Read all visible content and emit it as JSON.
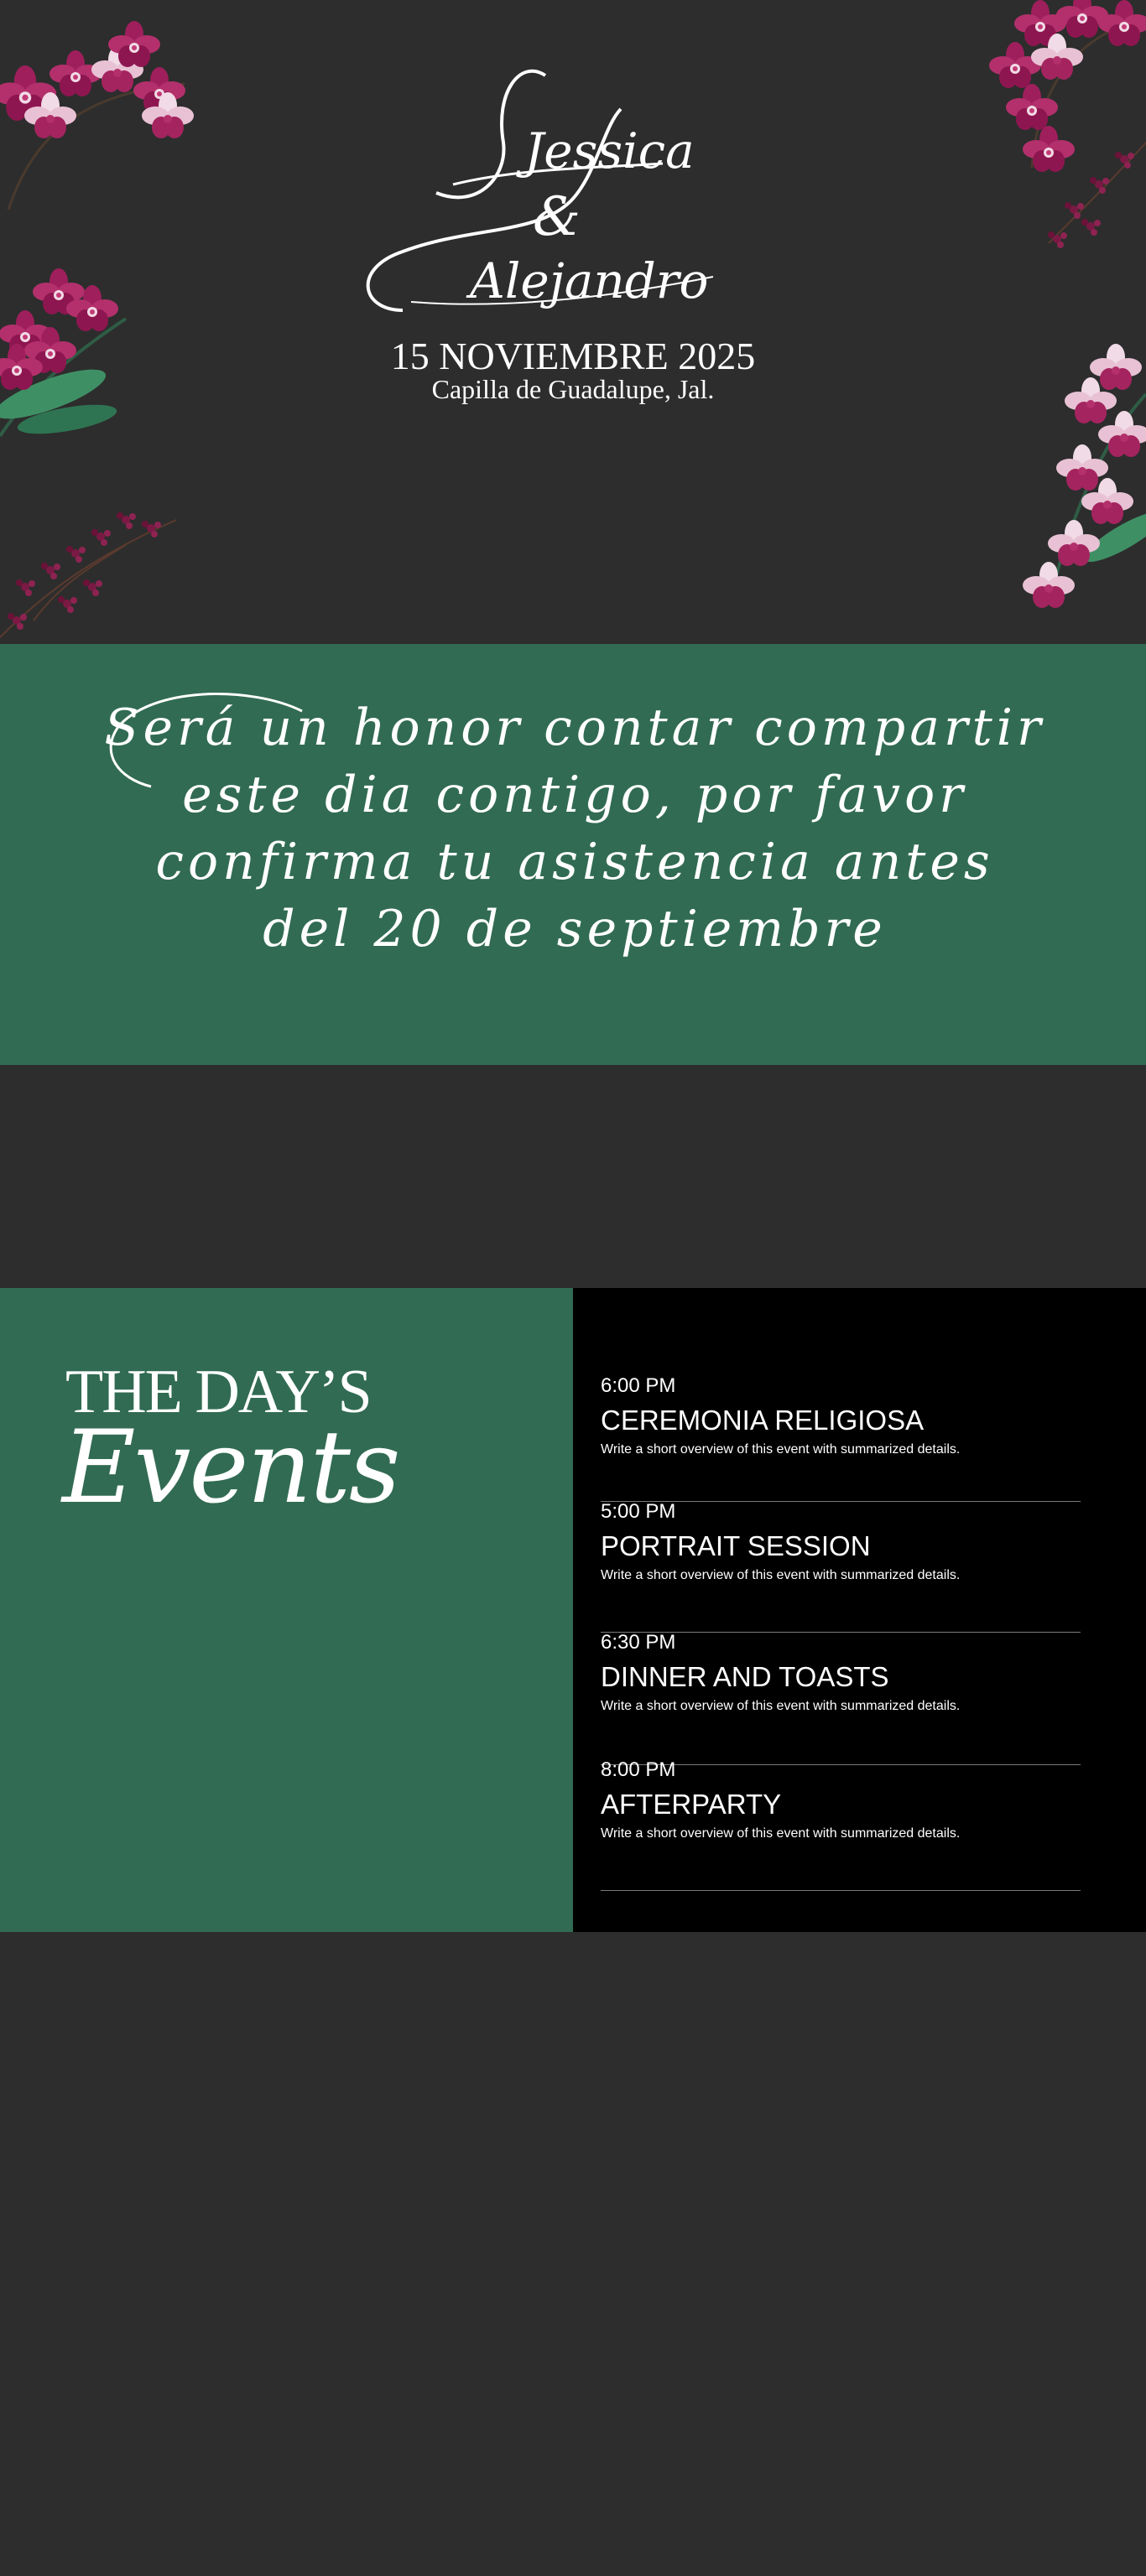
{
  "hero": {
    "name_first": "Jessica",
    "ampersand": "&",
    "name_second": "Alejandro",
    "date": "15 NOVIEMBRE 2025",
    "venue": "Capilla de Guadalupe, Jal."
  },
  "rsvp": {
    "lines": [
      "Será un honor contar compartir",
      "este dia contigo, por favor",
      "confirma tu asistencia antes",
      "del 20 de septiembre"
    ]
  },
  "events": {
    "title_top": "THE DAY’S",
    "title_script": "Events",
    "items": [
      {
        "time": "6:00 PM",
        "name": "CEREMONIA RELIGIOSA",
        "desc": "Write a short overview of this event with summarized details."
      },
      {
        "time": "5:00 PM",
        "name": "PORTRAIT SESSION",
        "desc": "Write a short overview of this event with summarized details."
      },
      {
        "time": "6:30 PM",
        "name": "DINNER AND TOASTS",
        "desc": "Write a short overview of this event with summarized details."
      },
      {
        "time": "8:00 PM",
        "name": "AFTERPARTY",
        "desc": "Write a short overview of this event with summarized details."
      }
    ]
  },
  "colors": {
    "background": "#2d2d2d",
    "green": "#316b53",
    "black": "#000000",
    "orchid": "#9e1f5c",
    "orchid_light": "#f1dbe6",
    "leaf": "#3f8f65"
  },
  "icons": [
    "orchid-cluster-icon",
    "berry-branch-icon"
  ]
}
